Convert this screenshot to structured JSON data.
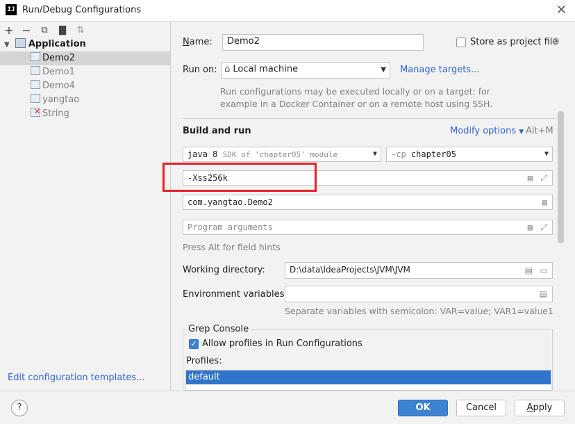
{
  "window": {
    "title": "Run/Debug Configurations",
    "app_icon_text": "IJ",
    "close_glyph": "✕"
  },
  "left_panel": {
    "toolbar": [
      "add-icon",
      "remove-icon",
      "copy-icon",
      "folder-icon",
      "sort-icon"
    ],
    "group_label": "Application",
    "items": [
      {
        "label": "Demo2",
        "selected": true
      },
      {
        "label": "Demo1",
        "selected": false
      },
      {
        "label": "Demo4",
        "selected": false
      },
      {
        "label": "yangtao",
        "selected": false
      },
      {
        "label": "String",
        "selected": false,
        "error": true
      }
    ],
    "edit_templates_link": "Edit configuration templates..."
  },
  "form": {
    "name_label": "Name:",
    "name_value": "Demo2",
    "store_label": "Store as project file",
    "run_on_label": "Run on:",
    "run_on_value": "Local machine",
    "manage_targets": "Manage targets...",
    "run_on_desc_line1": "Run configurations may be executed locally or on a target: for",
    "run_on_desc_line2": "example in a Docker Container or on a remote host using SSH.",
    "build_and_run_label": "Build and run",
    "modify_options": "Modify options",
    "modify_shortcut": "Alt+M",
    "jdk_version": "java 8",
    "jdk_desc": "SDK of 'chapter05' module",
    "cp_flag": "-cp",
    "cp_value": "chapter05",
    "vm_options": "-Xss256k",
    "main_class": "com.yangtao.Demo2",
    "program_args_placeholder": "Program arguments",
    "field_hint": "Press Alt for field hints",
    "working_dir_label": "Working directory:",
    "working_dir_value": "D:\\data\\IdeaProjects\\JVM\\JVM",
    "env_vars_label": "Environment variables:",
    "env_vars_value": "",
    "env_hint": "Separate variables with semicolon: VAR=value; VAR1=value1",
    "grep_console_label": "Grep Console",
    "allow_profiles_label": "Allow profiles in Run Configurations",
    "allow_profiles_checked": true,
    "profiles_label": "Profiles:",
    "profiles": [
      "default"
    ]
  },
  "buttons": {
    "ok": "OK",
    "cancel": "Cancel",
    "apply": "Apply",
    "help": "?"
  },
  "colors": {
    "accent": "#3d83d0",
    "link": "#2f65ca",
    "highlight_box": "#e8202a"
  }
}
